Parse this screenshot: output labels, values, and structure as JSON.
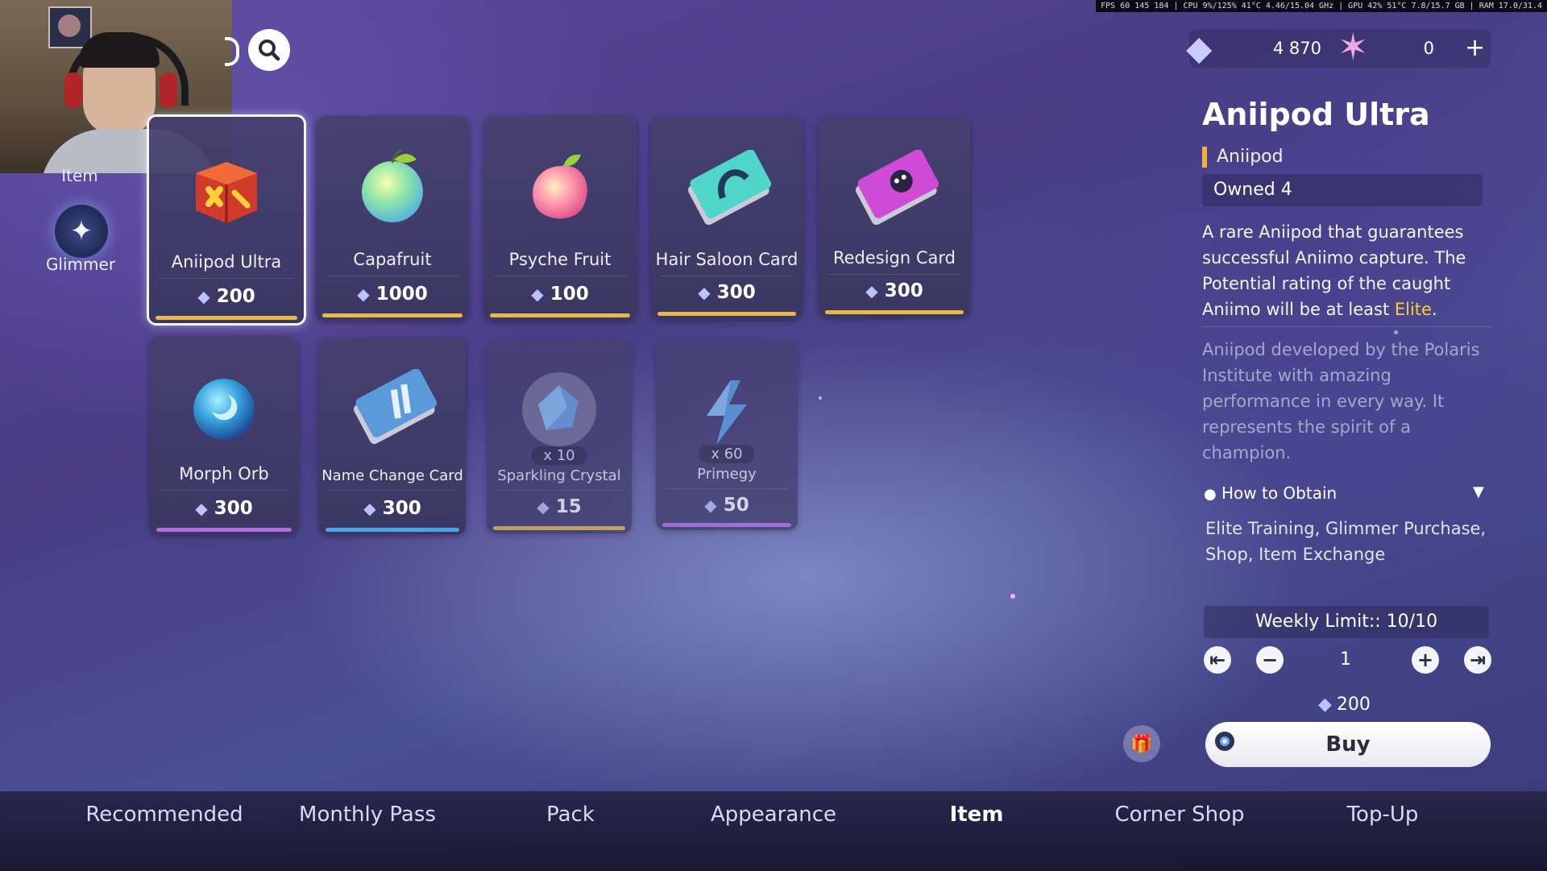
{
  "overlay": {
    "stats_text": "FPS 60 145 184 | CPU 9%/125% 41°C 4.46/15.04 GHz | GPU 42% 51°C 7.8/15.7 GB | RAM 17.0/31.4"
  },
  "left_nav": {
    "item_label": "Item",
    "glimmer_label": "Glimmer"
  },
  "currency": {
    "glimmer_amount": "4 870",
    "star_amount": "0",
    "add_symbol": "+"
  },
  "items": [
    {
      "name": "Aniipod Ultra",
      "price": "200",
      "bar_color": "#e9b84a",
      "selected": true
    },
    {
      "name": "Capafruit",
      "price": "1000",
      "bar_color": "#e9b84a"
    },
    {
      "name": "Psyche Fruit",
      "price": "100",
      "bar_color": "#e9b84a"
    },
    {
      "name": "Hair Saloon Card",
      "price": "300",
      "bar_color": "#e9b84a"
    },
    {
      "name": "Redesign Card",
      "price": "300",
      "bar_color": "#e9b84a"
    },
    {
      "name": "Morph Orb",
      "price": "300",
      "bar_color": "#b06fe0"
    },
    {
      "name": "Name Change Card",
      "price": "300",
      "bar_color": "#4ea4e8"
    },
    {
      "name": "Sparkling Crystal",
      "price": "15",
      "qty": "x 10",
      "bar_color": "#e9b84a"
    },
    {
      "name": "Primegy",
      "price": "50",
      "qty": "x 60",
      "bar_color": "#b06fe0"
    }
  ],
  "detail": {
    "title": "Aniipod Ultra",
    "category": "Aniipod",
    "owned": "Owned 4",
    "desc_part1": "A rare Aniipod that guarantees successful Aniimo capture. The Potential rating of the caught Aniimo will be at least ",
    "desc_highlight": "Elite",
    "desc_part2": ".",
    "lore": "Aniipod developed by the Polaris Institute with amazing performance in every way. It represents the spirit of a champion.",
    "how_to_obtain_label": "How to Obtain",
    "obtain_sources": "Elite Training, Glimmer Purchase, Shop, Item Exchange",
    "weekly_limit": "Weekly Limit:: 10/10",
    "quantity": "1",
    "total_price": "200",
    "buy_label": "Buy"
  },
  "tabs": [
    {
      "label": "Recommended"
    },
    {
      "label": "Monthly Pass"
    },
    {
      "label": "Pack"
    },
    {
      "label": "Appearance"
    },
    {
      "label": "Item",
      "active": true
    },
    {
      "label": "Corner Shop"
    },
    {
      "label": "Top-Up"
    }
  ],
  "icons": {
    "glimmer_currency": "crystal-icon",
    "star_currency": "star-icon",
    "search": "search-icon"
  }
}
